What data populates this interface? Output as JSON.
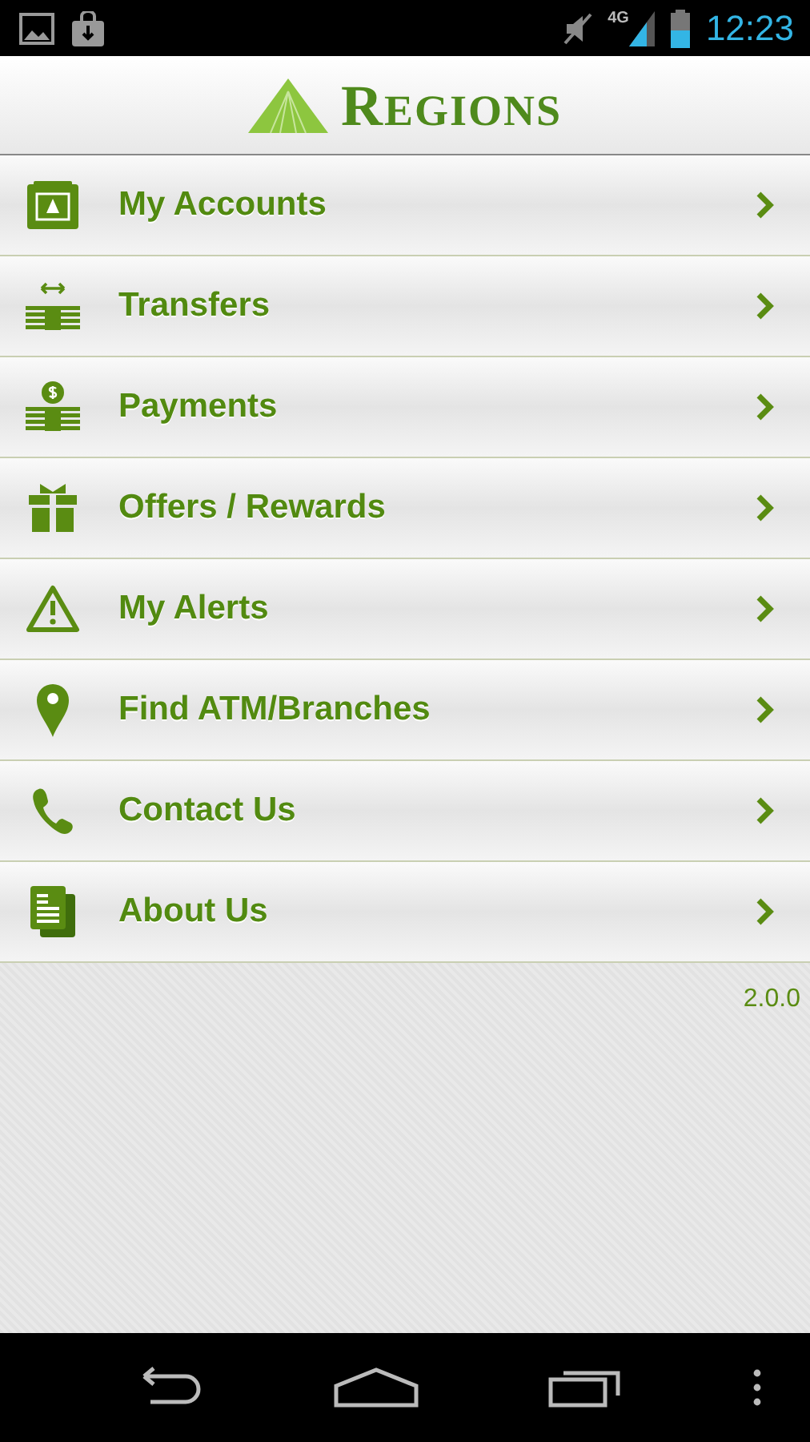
{
  "status_bar": {
    "network": "4G",
    "time": "12:23"
  },
  "header": {
    "logo": "REGIONS"
  },
  "menu": [
    {
      "label": "My Accounts"
    },
    {
      "label": "Transfers"
    },
    {
      "label": "Payments"
    },
    {
      "label": "Offers / Rewards"
    },
    {
      "label": "My Alerts"
    },
    {
      "label": "Find ATM/Branches"
    },
    {
      "label": "Contact Us"
    },
    {
      "label": "About Us"
    }
  ],
  "version": "2.0.0"
}
